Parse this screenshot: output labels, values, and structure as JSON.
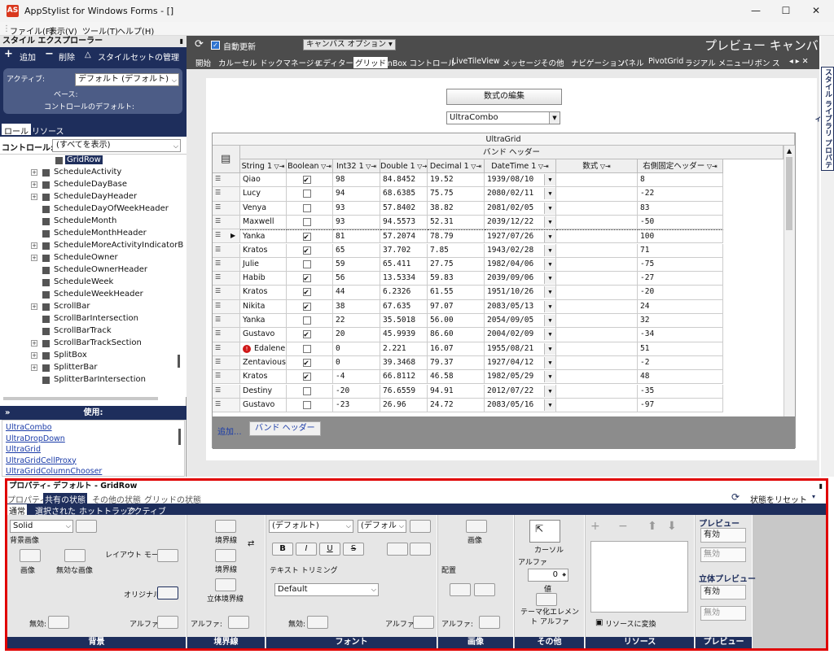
{
  "window": {
    "title": "AppStylist for Windows Forms - []",
    "icon_label": "AS",
    "minimize": "—",
    "maximize": "☐",
    "close": "✕"
  },
  "menu": [
    "ファイル(F)",
    "表示(V)",
    "ツール(T)",
    "ヘルプ(H)"
  ],
  "style_explorer": {
    "title": "スタイル エクスプローラー",
    "pin": "📌",
    "toolbar": {
      "add": "追加",
      "delete": "削除",
      "manage": "スタイルセットの管理"
    },
    "active_label": "アクティブ:",
    "active_value": "デフォルト (デフォルト)",
    "base_label": "ベース:",
    "control_default_label": "コントロールのデフォルト:",
    "tabs": [
      "ロール",
      "リソース"
    ],
    "control_label": "コントロール:",
    "control_value": "(すべてを表示)",
    "tree": [
      {
        "label": "GridRow",
        "expandable": false,
        "selected": true
      },
      {
        "label": "ScheduleActivity",
        "expandable": true
      },
      {
        "label": "ScheduleDayBase",
        "expandable": true
      },
      {
        "label": "ScheduleDayHeader",
        "expandable": true
      },
      {
        "label": "ScheduleDayOfWeekHeader",
        "expandable": false
      },
      {
        "label": "ScheduleMonth",
        "expandable": false
      },
      {
        "label": "ScheduleMonthHeader",
        "expandable": false
      },
      {
        "label": "ScheduleMoreActivityIndicatorB",
        "expandable": true
      },
      {
        "label": "ScheduleOwner",
        "expandable": true
      },
      {
        "label": "ScheduleOwnerHeader",
        "expandable": false
      },
      {
        "label": "ScheduleWeek",
        "expandable": false
      },
      {
        "label": "ScheduleWeekHeader",
        "expandable": false
      },
      {
        "label": "ScrollBar",
        "expandable": true
      },
      {
        "label": "ScrollBarIntersection",
        "expandable": false
      },
      {
        "label": "ScrollBarTrack",
        "expandable": false
      },
      {
        "label": "ScrollBarTrackSection",
        "expandable": true
      },
      {
        "label": "SplitBox",
        "expandable": true
      },
      {
        "label": "SplitterBar",
        "expandable": true
      },
      {
        "label": "SplitterBarIntersection",
        "expandable": false
      }
    ],
    "usage_title": "使用:",
    "usage_items": [
      "UltraCombo",
      "UltraDropDown",
      "UltraGrid",
      "UltraGridCellProxy",
      "UltraGridColumnChooser"
    ]
  },
  "preview": {
    "auto_update_label": "自動更新",
    "canvas_options": "キャンバス オプション ▾",
    "title": "プレビュー キャンバス",
    "tabs": [
      "開始",
      "カルーセル",
      "ドックマネージャ",
      "エディター",
      "グリッド",
      "InBox コントロール",
      "LiveTileView",
      "メッセージ",
      "その他",
      "ナビゲーション",
      "パネル",
      "PivotGrid",
      "ラジアル メニュー",
      "リボン",
      "ス"
    ],
    "active_tab": "グリッド",
    "formula_button": "数式の編集",
    "combo_value": "UltraCombo",
    "grid": {
      "caption": "UltraGrid",
      "band_header": "バンド ヘッダー",
      "columns": [
        "String 1",
        "Boolean",
        "Int32 1",
        "Double 1",
        "Decimal 1",
        "DateTime 1",
        "数式",
        "右側固定ヘッダー"
      ],
      "rows": [
        [
          "Qiao",
          true,
          "98",
          "84.8452",
          "19.52",
          "1939/08/10",
          "",
          "8"
        ],
        [
          "Lucy",
          false,
          "94",
          "68.6385",
          "75.75",
          "2080/02/11",
          "",
          "-22"
        ],
        [
          "Venya",
          false,
          "93",
          "57.8402",
          "38.82",
          "2081/02/05",
          "",
          "83"
        ],
        [
          "Maxwell",
          false,
          "93",
          "94.5573",
          "52.31",
          "2039/12/22",
          "",
          "-50"
        ],
        [
          "Yanka",
          true,
          "81",
          "57.2074",
          "78.79",
          "1927/07/26",
          "",
          "100"
        ],
        [
          "Kratos",
          true,
          "65",
          "37.702",
          "7.85",
          "1943/02/28",
          "",
          "71"
        ],
        [
          "Julie",
          false,
          "59",
          "65.411",
          "27.75",
          "1982/04/06",
          "",
          "-75"
        ],
        [
          "Habib",
          true,
          "56",
          "13.5334",
          "59.83",
          "2039/09/06",
          "",
          "-27"
        ],
        [
          "Kratos",
          true,
          "44",
          "6.2326",
          "61.55",
          "1951/10/26",
          "",
          "-20"
        ],
        [
          "Nikita",
          true,
          "38",
          "67.635",
          "97.07",
          "2083/05/13",
          "",
          "24"
        ],
        [
          "Yanka",
          false,
          "22",
          "35.5018",
          "56.00",
          "2054/09/05",
          "",
          "32"
        ],
        [
          "Gustavo",
          true,
          "20",
          "45.9939",
          "86.60",
          "2004/02/09",
          "",
          "-34"
        ],
        [
          "Edalene",
          false,
          "0",
          "2.221",
          "16.07",
          "1955/08/21",
          "",
          "51"
        ],
        [
          "Zentavious",
          true,
          "0",
          "39.3468",
          "79.37",
          "1927/04/12",
          "",
          "-2"
        ],
        [
          "Kratos",
          true,
          "-4",
          "66.8112",
          "46.58",
          "1982/05/29",
          "",
          "48"
        ],
        [
          "Destiny",
          false,
          "-20",
          "76.6559",
          "94.91",
          "2012/07/22",
          "",
          "-35"
        ],
        [
          "Gustavo",
          false,
          "-23",
          "26.96",
          "24.72",
          "2083/05/16",
          "",
          "-97"
        ]
      ],
      "add_label": "追加...",
      "band_header_button": "バンド ヘッダー"
    }
  },
  "library_tab": "スタイル ライブラリ プロパティ",
  "properties": {
    "title": "プロパティ- デフォルト - GridRow",
    "tabs": [
      "プロパティ",
      "共有の状態",
      "その他の状態",
      "グリッドの状態"
    ],
    "active_tab": "共有の状態",
    "reset_label": "状態をリセット",
    "subtabs": [
      "通常",
      "選択された",
      "ホットトラック",
      "アクティブ"
    ],
    "active_subtab": "通常",
    "background": {
      "style_value": "Solid",
      "bg_image_label": "背景画像",
      "image_label": "画像",
      "disabled_image_label": "無効な画像",
      "layout_mode_label": "レイアウト モード:",
      "original_label": "オリジナル:",
      "disabled_label": "無効:",
      "alpha_label": "アルファ:",
      "group_label": "背景"
    },
    "border": {
      "border_label": "境界線",
      "border2_label": "境界線",
      "3d_label": "立体境界線",
      "alpha_label": "アルファ:",
      "group_label": "境界線"
    },
    "font": {
      "font_value": "(デフォルト)",
      "size_value": "(デフォル",
      "bold": "B",
      "italic": "I",
      "underline": "U",
      "strike": "S",
      "trim_label": "テキスト トリミング",
      "trim_value": "Default",
      "disabled_label": "無効:",
      "alpha_label": "アルファ:",
      "group_label": "フォント"
    },
    "image": {
      "image_label": "画像",
      "align_label": "配置",
      "alpha_label": "アルファ:",
      "group_label": "画像"
    },
    "other": {
      "cursor_label": "カーソル",
      "alpha_label": "アルファ",
      "alpha_value": "0",
      "value_label": "値",
      "theme_alpha_label": "テーマ化エレメント アルファ",
      "group_label": "その他"
    },
    "resources": {
      "convert_label": "リソースに変換",
      "group_label": "リソース"
    },
    "preview": {
      "preview_label": "プレビュー",
      "enabled": "有効",
      "disabled": "無効",
      "3d_preview_label": "立体プレビュー",
      "enabled2": "有効",
      "disabled2": "無効",
      "group_label": "プレビュー"
    }
  },
  "colors": {
    "navy": "#1e2e5c",
    "highlight_red": "#e00000",
    "link_blue": "#1a3ba8"
  }
}
